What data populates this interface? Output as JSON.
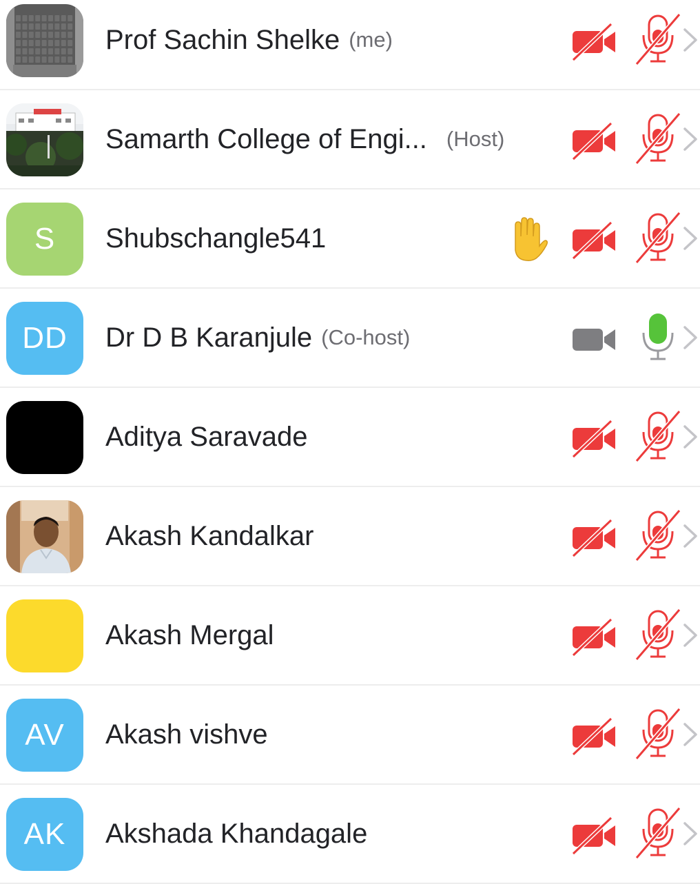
{
  "participants": [
    {
      "name": "Prof Sachin Shelke",
      "role": "(me)",
      "avatar": {
        "type": "photo",
        "icon": "laptop-keyboard-photo"
      },
      "hand_raised": false,
      "video": "off",
      "audio": "muted"
    },
    {
      "name": "Samarth College of Engi...",
      "role": "(Host)",
      "avatar": {
        "type": "photo",
        "icon": "college-building-photo"
      },
      "hand_raised": false,
      "video": "off",
      "audio": "muted"
    },
    {
      "name": "Shubschangle541",
      "role": "",
      "avatar": {
        "type": "initials",
        "initials": "S",
        "color": "#a6d572"
      },
      "hand_raised": true,
      "video": "off",
      "audio": "muted"
    },
    {
      "name": "Dr D B Karanjule",
      "role": "(Co-host)",
      "avatar": {
        "type": "initials",
        "initials": "DD",
        "color": "#55bdf2"
      },
      "hand_raised": false,
      "video": "on",
      "audio": "unmuted"
    },
    {
      "name": "Aditya Saravade",
      "role": "",
      "avatar": {
        "type": "color",
        "color": "#000000"
      },
      "hand_raised": false,
      "video": "off",
      "audio": "muted"
    },
    {
      "name": "Akash Kandalkar",
      "role": "",
      "avatar": {
        "type": "photo",
        "icon": "person-portrait-photo"
      },
      "hand_raised": false,
      "video": "off",
      "audio": "muted"
    },
    {
      "name": "Akash Mergal",
      "role": "",
      "avatar": {
        "type": "color",
        "color": "#fcda2c"
      },
      "hand_raised": false,
      "video": "off",
      "audio": "muted"
    },
    {
      "name": "Akash vishve",
      "role": "",
      "avatar": {
        "type": "initials",
        "initials": "AV",
        "color": "#55bdf2"
      },
      "hand_raised": false,
      "video": "off",
      "audio": "muted"
    },
    {
      "name": "Akshada Khandagale",
      "role": "",
      "avatar": {
        "type": "initials",
        "initials": "AK",
        "color": "#55bdf2"
      },
      "hand_raised": false,
      "video": "off",
      "audio": "muted"
    }
  ],
  "colors": {
    "muted_red": "#ec3b3b",
    "video_on_gray": "#7e7e81",
    "mic_on_green": "#56c33a",
    "chevron_gray": "#c4c4c8",
    "divider": "#ededed",
    "hand_yellow": "#f7c332"
  }
}
